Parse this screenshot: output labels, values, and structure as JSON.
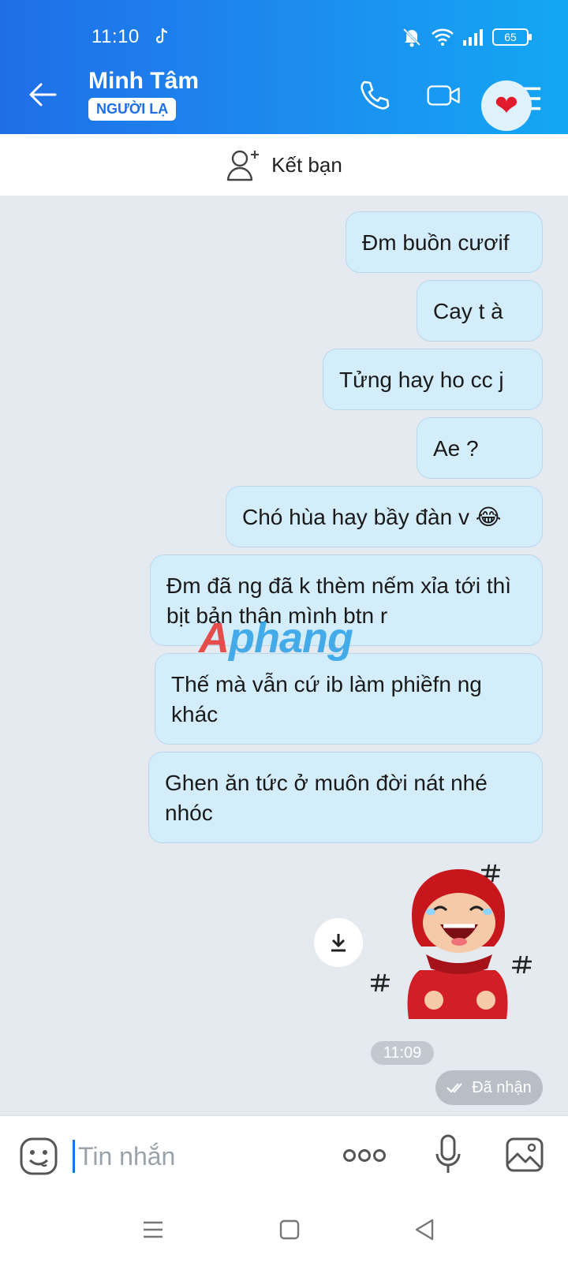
{
  "status": {
    "time": "11:10",
    "battery": "65"
  },
  "header": {
    "contact_name": "Minh Tâm",
    "badge": "NGƯỜI LẠ"
  },
  "add_friend": {
    "label": "Kết bạn"
  },
  "messages": [
    {
      "text": "Đm buồn cươif"
    },
    {
      "text": "Cay t à"
    },
    {
      "text": "Tửng hay ho cc j"
    },
    {
      "text": "Ae ?"
    },
    {
      "text": "Chó hùa hay bầy đàn v 😂"
    },
    {
      "text": "Đm đã ng đã k thèm nếm xỉa tới thì bịt bản thân mình btn r"
    },
    {
      "text": "Thế mà vẫn cứ ib làm phiềfn ng khác"
    },
    {
      "text": "Ghen ăn tức ở muôn đời nát nhé nhóc"
    }
  ],
  "sticker": {
    "icon": "laughing-red-hood-sticker"
  },
  "meta": {
    "time": "11:09",
    "status": "Đã nhận"
  },
  "composer": {
    "placeholder": "Tin nhắn"
  },
  "watermark": {
    "text": "Aphang"
  },
  "colors": {
    "accent": "#1c8df0",
    "bubble": "#d4edfb",
    "heart": "#e11b2b"
  }
}
